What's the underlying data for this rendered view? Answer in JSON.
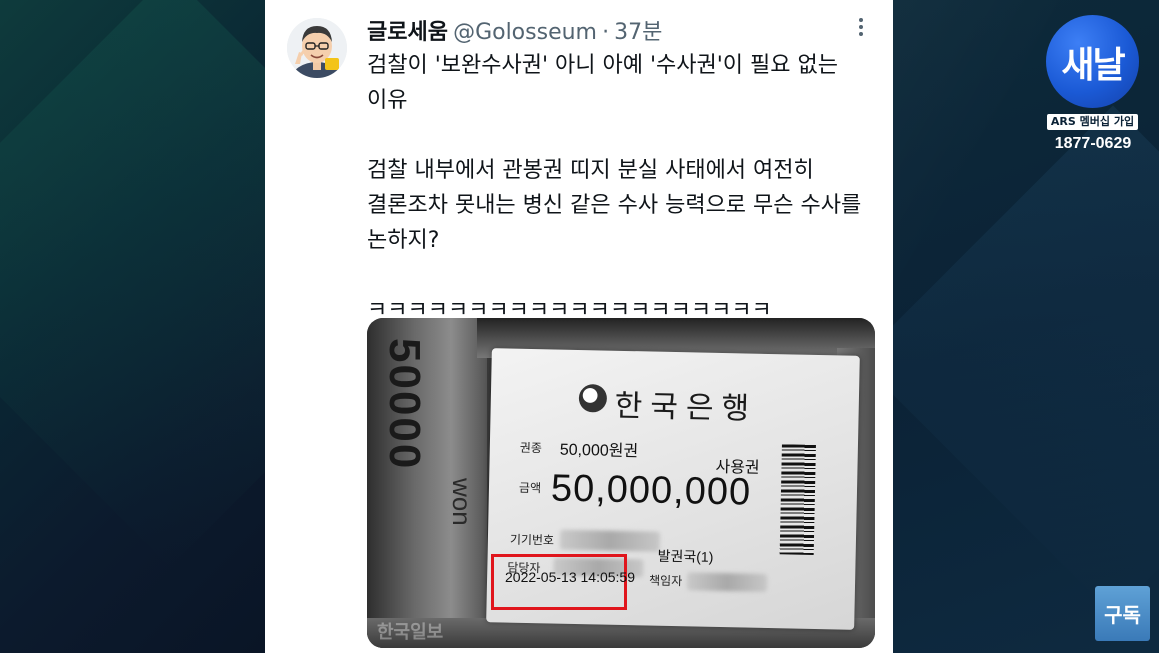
{
  "tweet": {
    "display_name": "글로세움",
    "handle": "@Golosseum",
    "separator": "·",
    "time": "37분",
    "line1": "검찰이 '보완수사권' 아니 아예 '수사권'이 필요 없는",
    "line2": "이유",
    "line3": "검찰 내부에서 관봉권 띠지 분실 사태에서 여전히",
    "line4": "결론조차 못내는 병신 같은 수사 능력으로 무슨 수사를",
    "line5": "논하지?",
    "line6": "ㅋㅋㅋㅋㅋㅋㅋㅋㅋㅋㅋㅋㅋㅋㅋㅋㅋㅋㅋㅋ"
  },
  "photo": {
    "banknote_number": "50000",
    "banknote_word": "won",
    "bank_name": "한국은행",
    "type_label": "권종",
    "type_value": "50,000원권",
    "usage": "사용권",
    "amount_label": "금액",
    "amount_value": "50,000,000",
    "machine_label": "기기번호",
    "issuer": "발권국(1)",
    "handler_label": "담당자",
    "responsible_label": "책임자",
    "date_stamp": "2022-05-13  14:05:59",
    "watermark": "한국일보",
    "highlight_color": "#e0151c"
  },
  "channel": {
    "logo_text": "새날",
    "ars_label": "ARS 멤버십 가입",
    "phone": "1877-0629",
    "subscribe_label": "구독"
  }
}
